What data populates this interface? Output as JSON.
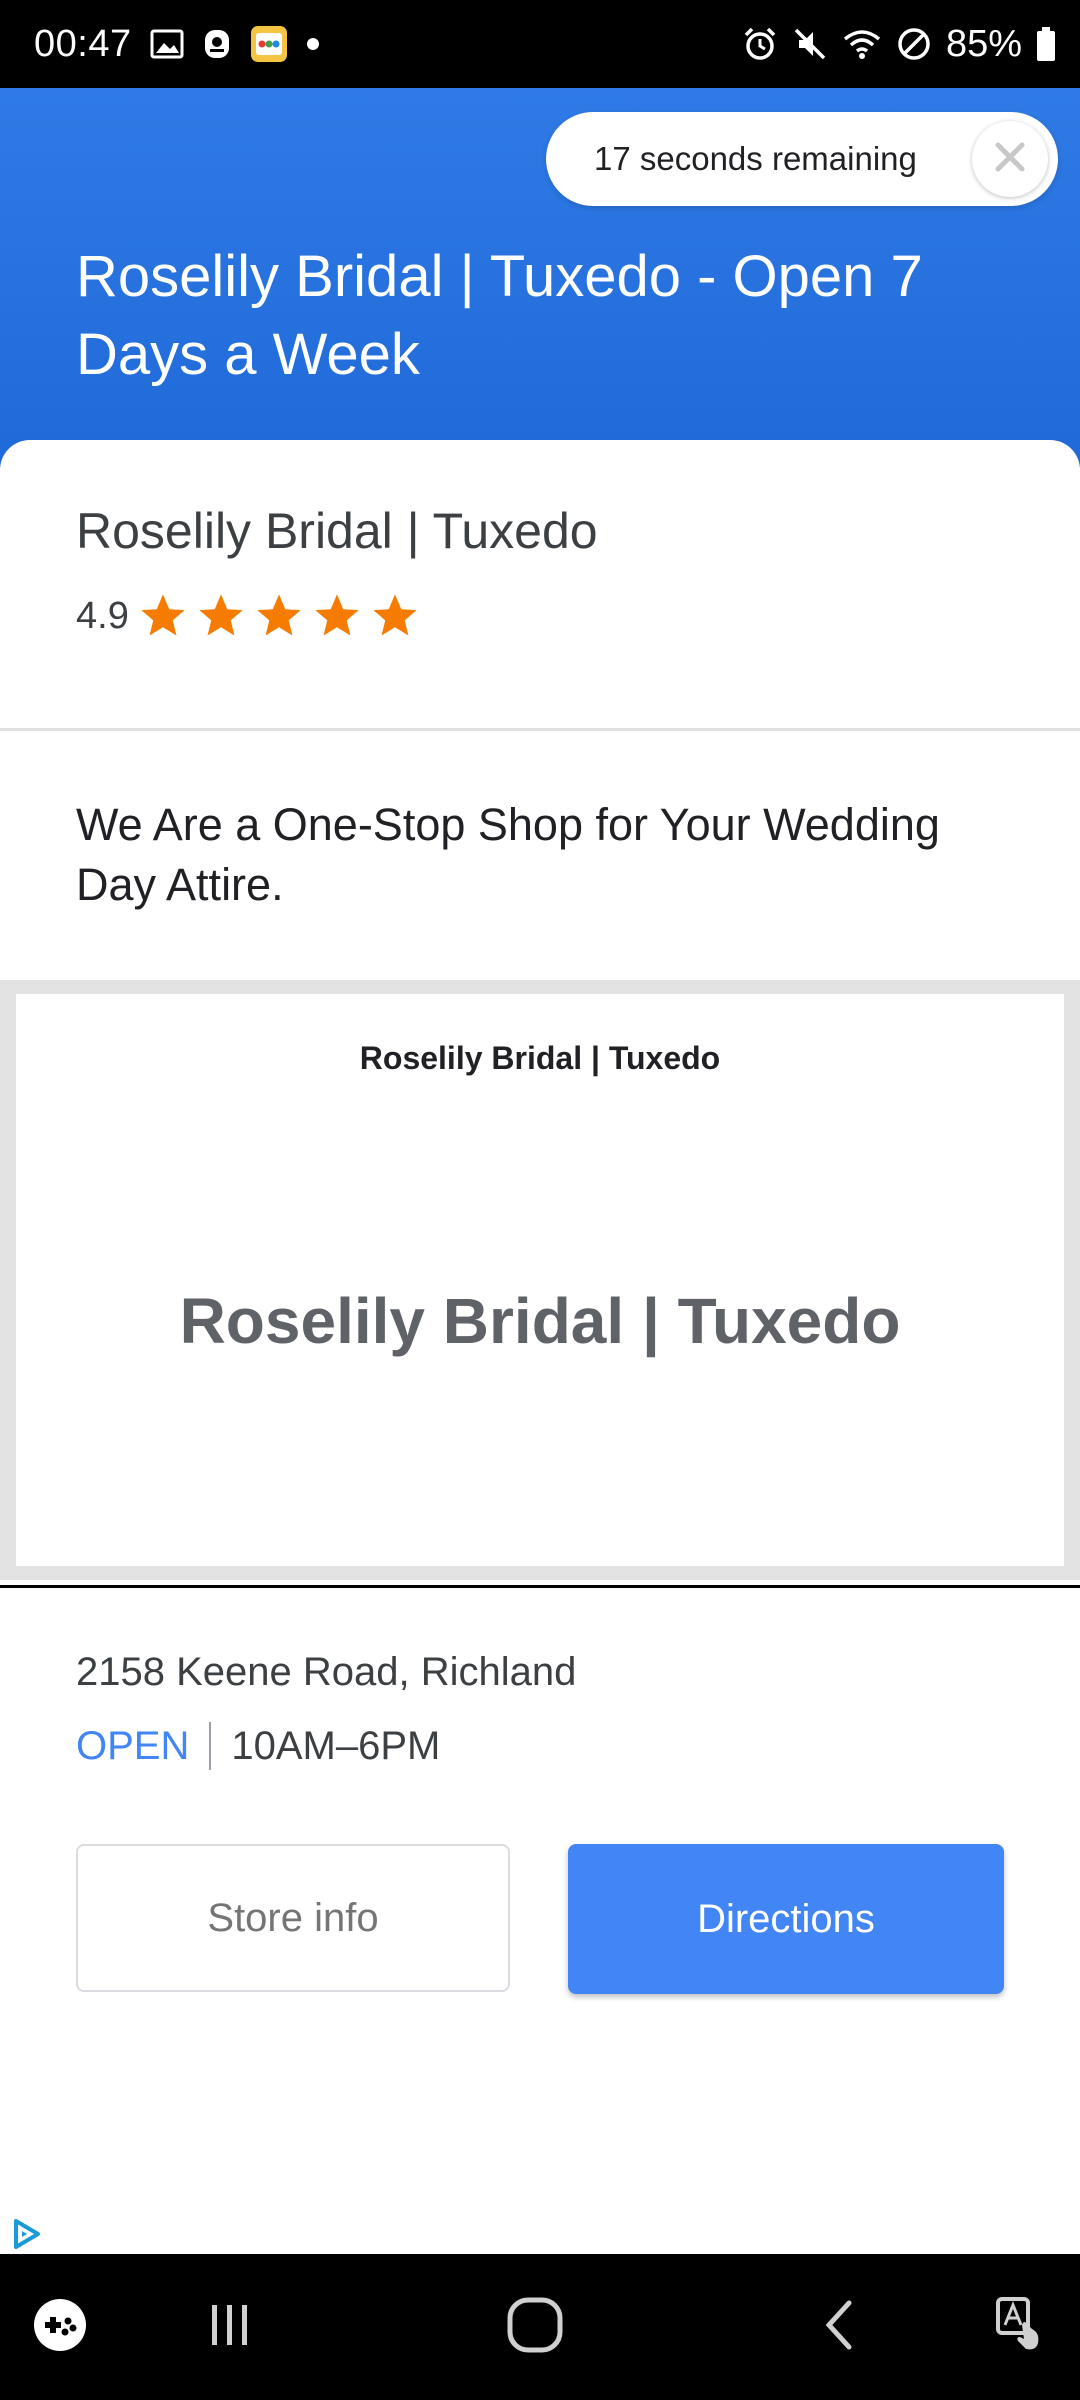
{
  "status_bar": {
    "time": "00:47",
    "battery": "85%",
    "left_icons": [
      "gallery-icon",
      "notification-icon",
      "game-app-icon",
      "dot-icon"
    ],
    "right_icons": [
      "alarm-icon",
      "mute-icon",
      "wifi-icon",
      "dnd-icon",
      "battery-icon"
    ]
  },
  "header": {
    "timer_text": "17 seconds remaining",
    "title": "Roselily Bridal | Tuxedo - Open 7 Days a Week",
    "background_color": "#2f7ae6"
  },
  "listing": {
    "name": "Roselily Bridal | Tuxedo",
    "rating": "4.9",
    "stars": 5,
    "star_color": "#f57c00",
    "tagline": "We Are a One-Stop Shop for Your Wedding Day Attire."
  },
  "image": {
    "small_title": "Roselily Bridal | Tuxedo",
    "big_title": "Roselily Bridal | Tuxedo"
  },
  "details": {
    "address": "2158 Keene Road, Richland",
    "status": "OPEN",
    "hours": "10AM–6PM"
  },
  "buttons": {
    "store_info": "Store info",
    "directions": "Directions",
    "accent_color": "#4285f4"
  },
  "nav_bar": {
    "icons": [
      "game-launcher-icon",
      "recents-icon",
      "home-icon",
      "back-icon",
      "accessibility-icon"
    ]
  }
}
